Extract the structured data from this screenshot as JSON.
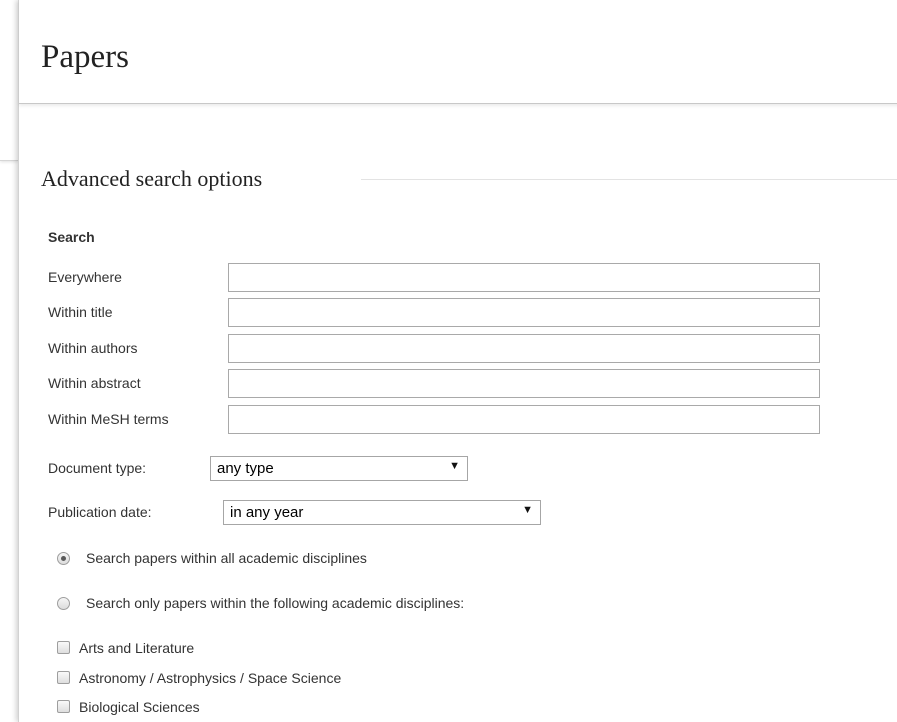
{
  "page": {
    "title": "Papers"
  },
  "advanced": {
    "legend": "Advanced search options",
    "search_label": "Search",
    "fields": [
      {
        "label": "Everywhere",
        "value": "",
        "placeholder": ""
      },
      {
        "label": "Within title",
        "value": "",
        "placeholder": ""
      },
      {
        "label": "Within authors",
        "value": "",
        "placeholder": ""
      },
      {
        "label": "Within abstract",
        "value": "",
        "placeholder": ""
      },
      {
        "label": "Within MeSH terms",
        "value": "",
        "placeholder": ""
      }
    ],
    "document_type": {
      "label": "Document type:",
      "selected": "any type"
    },
    "publication_date": {
      "label": "Publication date:",
      "selected": "in any year"
    },
    "radios": [
      {
        "label": "Search papers within all academic disciplines",
        "checked": true
      },
      {
        "label": "Search only papers within the following academic disciplines:",
        "checked": false
      }
    ],
    "disciplines": [
      {
        "label": "Arts and Literature",
        "checked": false
      },
      {
        "label": "Astronomy / Astrophysics / Space Science",
        "checked": false
      },
      {
        "label": "Biological Sciences",
        "checked": false
      }
    ],
    "icons": {
      "dropdown": "triangle-down-icon"
    }
  }
}
